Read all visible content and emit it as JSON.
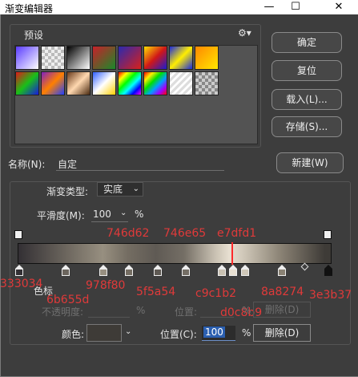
{
  "window": {
    "title": "渐变编辑器",
    "minimize": "—",
    "maximize": "☐",
    "close": "✕"
  },
  "presets": {
    "label": "预设",
    "gear": "⚙▾"
  },
  "buttons": {
    "ok": "确定",
    "reset": "复位",
    "load": "载入(L)...",
    "save": "存储(S)...",
    "new": "新建(W)"
  },
  "name": {
    "label": "名称(N):",
    "value": "自定"
  },
  "gradient_type": {
    "label": "渐变类型:",
    "value": "实底"
  },
  "smoothness": {
    "label": "平滑度(M):",
    "value": "100",
    "unit": "%"
  },
  "color_stop_labels": {
    "s1": "333034",
    "s2": "6b655d",
    "s3": "978f80",
    "s4": "746d62",
    "s5": "5f5a54",
    "s6": "746e65",
    "s7": "c9c1b2",
    "s8": "e7dfd1",
    "s9": "d0c8b9",
    "s10": "8a8274",
    "s11": "3e3b37"
  },
  "stops_section": {
    "label": "色标",
    "opacity_label": "不透明度:",
    "opacity_unit": "%",
    "opacity_position_label": "位置:",
    "opacity_position_unit": "%",
    "opacity_delete": "删除(D)",
    "color_label": "颜色:",
    "color_position_label": "位置(C):",
    "color_position_value": "100",
    "color_position_unit": "%",
    "color_delete": "删除(D)"
  },
  "colors": {
    "selected_stop": "#3e3b37",
    "midpoint": "#ff2a2a",
    "hex_text": "#e03a3a"
  }
}
